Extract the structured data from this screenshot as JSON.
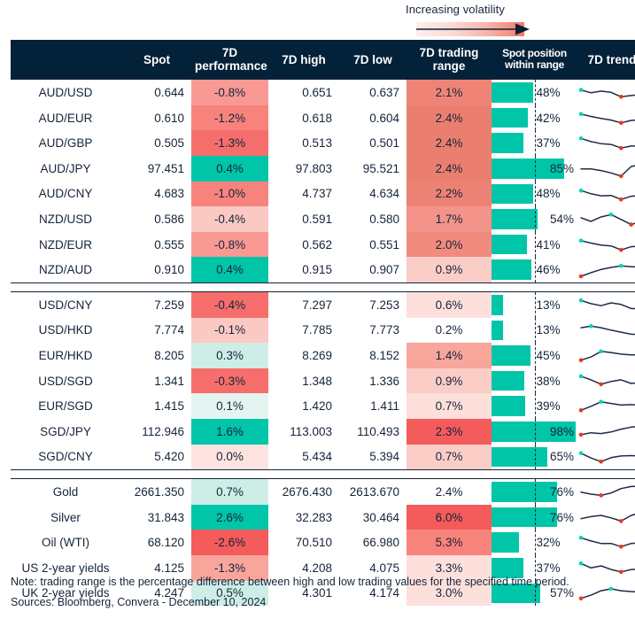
{
  "legend": {
    "label": "Increasing volatility",
    "gradient_from": "#fdeeeb",
    "gradient_to": "#ef7b6b",
    "arrow_color": "#0d1f33"
  },
  "header": {
    "navy": "#032138",
    "columns": [
      {
        "label": "",
        "key": "name"
      },
      {
        "label": "Spot",
        "key": "spot"
      },
      {
        "label": "7D performance",
        "key": "performance"
      },
      {
        "label": "7D high",
        "key": "high"
      },
      {
        "label": "7D low",
        "key": "low"
      },
      {
        "label": "7D trading range",
        "key": "range"
      },
      {
        "label": "Spot position within range",
        "key": "position"
      },
      {
        "label": "7D trend",
        "key": "trend"
      }
    ]
  },
  "colors": {
    "teal": "#00c5a8",
    "teal_light": "#cdeee7",
    "red_strong": "#f45b5b",
    "red_mid": "#f89a93",
    "red_light": "#fbc9c3",
    "red_faint": "#fde3df",
    "text": "#15243a",
    "spark_line": "#1b2c45",
    "spark_dot_high": "#00d3b8",
    "spark_dot_low": "#e8381f"
  },
  "groups": [
    {
      "name": "aud-nzd-crosses",
      "rows": [
        {
          "name": "AUD/USD",
          "spot": "0.644",
          "performance": "-0.8%",
          "perf_bg": "#f89a93",
          "high": "0.651",
          "low": "0.637",
          "range": "2.1%",
          "range_bg": "#ef8476",
          "position": "48%",
          "position_value": 48,
          "spark": [
            38,
            52,
            44,
            50,
            72,
            66,
            60
          ]
        },
        {
          "name": "AUD/EUR",
          "spot": "0.610",
          "performance": "-1.2%",
          "perf_bg": "#f8837c",
          "high": "0.618",
          "low": "0.604",
          "range": "2.4%",
          "range_bg": "#ea7f70",
          "position": "42%",
          "position_value": 42,
          "spark": [
            30,
            42,
            52,
            60,
            74,
            62,
            58
          ]
        },
        {
          "name": "AUD/GBP",
          "spot": "0.505",
          "performance": "-1.3%",
          "perf_bg": "#f66e6b",
          "high": "0.513",
          "low": "0.501",
          "range": "2.4%",
          "range_bg": "#ea7f70",
          "position": "37%",
          "position_value": 37,
          "spark": [
            28,
            44,
            54,
            58,
            76,
            66,
            66
          ]
        },
        {
          "name": "AUD/JPY",
          "spot": "97.451",
          "performance": "0.4%",
          "perf_bg": "#00c5a8",
          "high": "97.803",
          "low": "95.521",
          "range": "2.4%",
          "range_bg": "#ea7f70",
          "position": "85%",
          "position_value": 85,
          "spark": [
            52,
            52,
            60,
            72,
            88,
            40,
            30
          ]
        },
        {
          "name": "AUD/CNY",
          "spot": "4.683",
          "performance": "-1.0%",
          "perf_bg": "#f8837c",
          "high": "4.737",
          "low": "4.634",
          "range": "2.2%",
          "range_bg": "#ec8274",
          "position": "48%",
          "position_value": 48,
          "spark": [
            32,
            48,
            58,
            56,
            76,
            60,
            56
          ]
        },
        {
          "name": "NZD/USD",
          "spot": "0.586",
          "performance": "-0.4%",
          "perf_bg": "#fbc9c3",
          "high": "0.591",
          "low": "0.580",
          "range": "1.7%",
          "range_bg": "#f39389",
          "position": "54%",
          "position_value": 54,
          "spark": [
            44,
            62,
            40,
            28,
            52,
            78,
            62
          ]
        },
        {
          "name": "NZD/EUR",
          "spot": "0.555",
          "performance": "-0.8%",
          "perf_bg": "#f89a93",
          "high": "0.562",
          "low": "0.551",
          "range": "2.0%",
          "range_bg": "#f08b7e",
          "position": "41%",
          "position_value": 41,
          "spark": [
            30,
            42,
            52,
            56,
            76,
            60,
            56
          ]
        },
        {
          "name": "NZD/AUD",
          "spot": "0.910",
          "performance": "0.4%",
          "perf_bg": "#00c5a8",
          "high": "0.915",
          "low": "0.907",
          "range": "0.9%",
          "range_bg": "#fbcdc7",
          "position": "46%",
          "position_value": 46,
          "spark": [
            84,
            66,
            50,
            40,
            32,
            36,
            38
          ]
        }
      ]
    },
    {
      "name": "asia-crosses",
      "rows": [
        {
          "name": "USD/CNY",
          "spot": "7.259",
          "performance": "-0.4%",
          "perf_bg": "#f66e6b",
          "high": "7.297",
          "low": "7.253",
          "range": "0.6%",
          "range_bg": "#fde0dc",
          "position": "13%",
          "position_value": 13,
          "spark": [
            28,
            44,
            54,
            40,
            48,
            68,
            70
          ]
        },
        {
          "name": "USD/HKD",
          "spot": "7.774",
          "performance": "-0.1%",
          "perf_bg": "#fbc9c3",
          "high": "7.785",
          "low": "7.773",
          "range": "0.2%",
          "range_bg": "#ffffff",
          "position": "13%",
          "position_value": 13,
          "spark": [
            36,
            28,
            36,
            48,
            58,
            68,
            70
          ]
        },
        {
          "name": "EUR/HKD",
          "spot": "8.205",
          "performance": "0.3%",
          "perf_bg": "#cdeee7",
          "high": "8.269",
          "low": "8.152",
          "range": "1.4%",
          "range_bg": "#f8a69c",
          "position": "45%",
          "position_value": 45,
          "spark": [
            74,
            58,
            30,
            36,
            44,
            48,
            48
          ]
        },
        {
          "name": "USD/SGD",
          "spot": "1.341",
          "performance": "-0.3%",
          "perf_bg": "#f66e6b",
          "high": "1.348",
          "low": "1.336",
          "range": "0.9%",
          "range_bg": "#fbcdc7",
          "position": "38%",
          "position_value": 38,
          "spark": [
            26,
            44,
            66,
            52,
            44,
            62,
            58
          ]
        },
        {
          "name": "EUR/SGD",
          "spot": "1.415",
          "performance": "0.1%",
          "perf_bg": "#e4f5f1",
          "high": "1.420",
          "low": "1.411",
          "range": "0.7%",
          "range_bg": "#fde0dc",
          "position": "39%",
          "position_value": 39,
          "spark": [
            72,
            52,
            30,
            38,
            46,
            44,
            48
          ]
        },
        {
          "name": "SGD/JPY",
          "spot": "112.946",
          "performance": "1.6%",
          "perf_bg": "#00c5a8",
          "high": "113.003",
          "low": "110.493",
          "range": "2.3%",
          "range_bg": "#f45b5b",
          "position": "98%",
          "position_value": 98,
          "spark": [
            66,
            56,
            60,
            52,
            38,
            28,
            24
          ]
        },
        {
          "name": "SGD/CNY",
          "spot": "5.420",
          "performance": "0.0%",
          "perf_bg": "#fde3df",
          "high": "5.434",
          "low": "5.394",
          "range": "0.7%",
          "range_bg": "#fbcdc7",
          "position": "65%",
          "position_value": 65,
          "spark": [
            30,
            54,
            72,
            52,
            44,
            42,
            44
          ]
        }
      ]
    },
    {
      "name": "commodities-and-yields",
      "rows": [
        {
          "name": "Gold",
          "spot": "2661.350",
          "performance": "0.7%",
          "perf_bg": "#cdeee7",
          "high": "2676.430",
          "low": "2613.670",
          "range": "2.4%",
          "range_bg": "#ffffff",
          "position": "76%",
          "position_value": 76,
          "spark": [
            52,
            62,
            68,
            56,
            34,
            24,
            22
          ]
        },
        {
          "name": "Silver",
          "spot": "31.843",
          "performance": "2.6%",
          "perf_bg": "#00c5a8",
          "high": "32.283",
          "low": "30.464",
          "range": "6.0%",
          "range_bg": "#f45b5b",
          "position": "76%",
          "position_value": 76,
          "spark": [
            56,
            46,
            40,
            52,
            68,
            40,
            26
          ]
        },
        {
          "name": "Oil (WTI)",
          "spot": "68.120",
          "performance": "-2.6%",
          "perf_bg": "#f45b5b",
          "high": "70.510",
          "low": "66.980",
          "range": "5.3%",
          "range_bg": "#f8837c",
          "position": "32%",
          "position_value": 32,
          "spark": [
            28,
            44,
            56,
            56,
            72,
            56,
            52
          ]
        },
        {
          "name": "US 2-year yields",
          "spot": "4.125",
          "performance": "-1.3%",
          "perf_bg": "#f8a69c",
          "high": "4.208",
          "low": "4.075",
          "range": "3.3%",
          "range_bg": "#fde0dc",
          "position": "37%",
          "position_value": 37,
          "spark": [
            28,
            50,
            40,
            58,
            70,
            58,
            56
          ]
        },
        {
          "name": "UK 2-year yields",
          "spot": "4.247",
          "performance": "0.5%",
          "perf_bg": "#cdeee7",
          "high": "4.301",
          "low": "4.174",
          "range": "3.0%",
          "range_bg": "#fde0dc",
          "position": "57%",
          "position_value": 57,
          "spark": [
            74,
            58,
            36,
            26,
            36,
            40,
            42
          ]
        }
      ]
    }
  ],
  "footnotes": [
    "Note: trading range is the percentage difference between high and low trading values for the specified time period.",
    "Sources: Bloomberg, Convera - December 10, 2024"
  ]
}
